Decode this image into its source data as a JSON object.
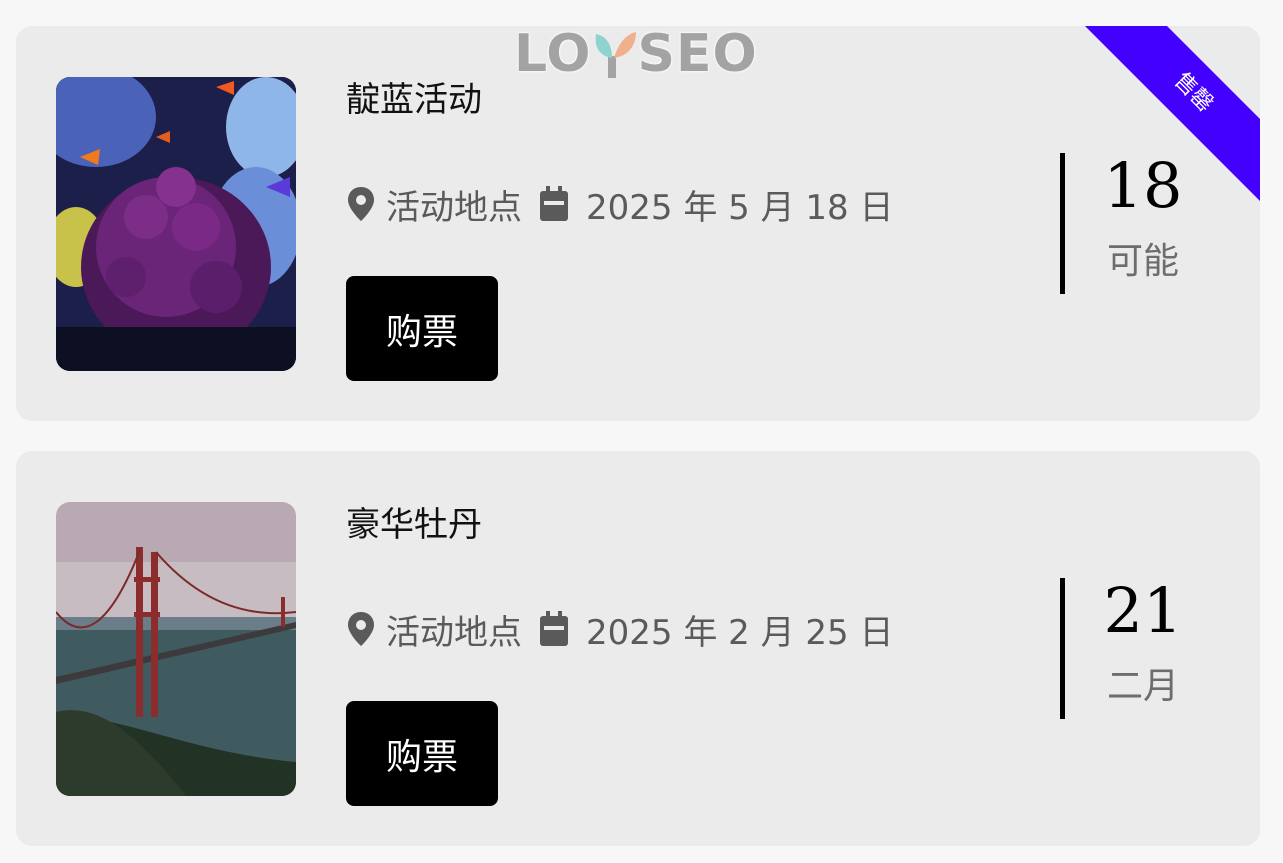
{
  "watermark": {
    "text_left": "LO",
    "text_right": "SEO"
  },
  "events": [
    {
      "title": "靛蓝活动",
      "location": "活动地点",
      "date_text": "2025 年 5 月 18 日",
      "button_label": "购票",
      "day": "18",
      "sub_label": "可能",
      "ribbon": "售罄",
      "image": "coral-reef-fish"
    },
    {
      "title": "豪华牡丹",
      "location": "活动地点",
      "date_text": "2025 年 2 月 25 日",
      "button_label": "购票",
      "day": "21",
      "sub_label": "二月",
      "image": "golden-gate-bridge"
    }
  ],
  "icons": {
    "location": "map-pin-icon",
    "date": "calendar-icon"
  },
  "colors": {
    "ribbon": "#4300ff",
    "button": "#000000",
    "card": "#ebebeb",
    "page": "#f7f7f7"
  }
}
